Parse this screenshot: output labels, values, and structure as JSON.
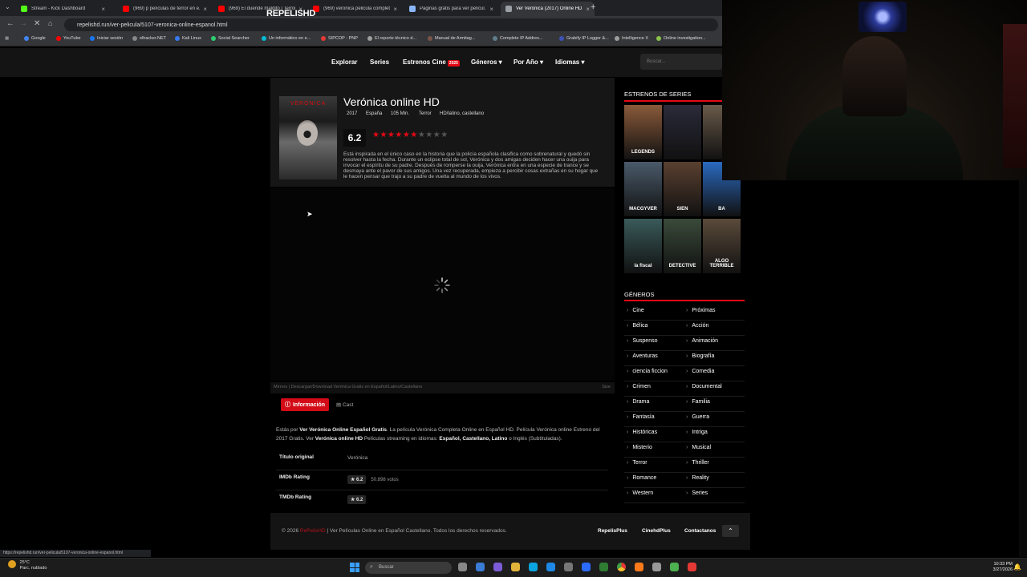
{
  "browser": {
    "tabs": [
      {
        "label": "Stream - Kick Dashboard",
        "color": "#53fc18"
      },
      {
        "label": "(969) p películas de terror en e...",
        "color": "#ff0000"
      },
      {
        "label": "(969) El duende maldito | Terror...",
        "color": "#ff0000"
      },
      {
        "label": "(969) veronica pelicula complet...",
        "color": "#ff0000"
      },
      {
        "label": "Páginas gratis para ver películ...",
        "color": "#8ab4f8"
      },
      {
        "label": "Ver Verónica (2017) Online HD...",
        "color": "#9aa0a6"
      }
    ],
    "new_tab": "+",
    "url": "repelishd.run/ver-pelicula/5107-veronica-online-espanol.html",
    "bookmarks": [
      {
        "label": "Google",
        "color": "#4285f4"
      },
      {
        "label": "YouTube",
        "color": "#ff0000"
      },
      {
        "label": "Iniciar sesión",
        "color": "#1877f2"
      },
      {
        "label": "elhacker.NET",
        "color": "#888888"
      },
      {
        "label": "Kali Linux",
        "color": "#367bf0"
      },
      {
        "label": "Social Searcher",
        "color": "#2ecc71"
      },
      {
        "label": "Un informático en e...",
        "color": "#00bcd4"
      },
      {
        "label": "SIPCOP - PNP",
        "color": "#e53935"
      },
      {
        "label": "El reporte técnico d...",
        "color": "#9e9e9e"
      },
      {
        "label": "Manual de Armitag...",
        "color": "#795548"
      },
      {
        "label": "Complete IP Addres...",
        "color": "#607d8b"
      },
      {
        "label": "Grabify IP Logger &...",
        "color": "#3f51b5"
      },
      {
        "label": "Intelligence X",
        "color": "#9e9e9e"
      },
      {
        "label": "Online investigation...",
        "color": "#8bc34a"
      }
    ],
    "status_url": "https://repelishd.run/ver-pelicula/5107-veronica-online-espanol.html"
  },
  "site": {
    "logo": "REPELISHD",
    "nav": {
      "explorar": "Explorar",
      "series": "Series",
      "estrenos": "Estrenos Cine",
      "estrenos_badge": "2025",
      "generos": "Géneros ▾",
      "por_anio": "Por Año ▾",
      "idiomas": "Idiomas ▾"
    },
    "search_placeholder": "Buscar..."
  },
  "movie": {
    "poster_title": "VERÓNICA",
    "title": "Verónica online HD",
    "year": "2017",
    "country": "España",
    "duration": "105 Min.",
    "genre": "Terror",
    "languages": "HD/latino, castellano",
    "rating": "6.2",
    "stars_filled": 6.2,
    "stars_total": 10,
    "synopsis": "Está inspirada en el único caso en la historia que la policía española clasifica como sobrenatural y quedó sin resolver hasta la fecha. Durante un eclipse total de sol, Verónica y dos amigas deciden hacer una ouija para invocar el espíritu de su padre. Después de romperse la ouija, Verónica entra en una especie de trance y se desmaya ante el pavor de sus amigos. Una vez recuperada, empieza a percibir cosas extrañas en su hogar que le hacen pensar que trajo a su padre de vuelta al mundo de los vivos."
  },
  "player": {
    "mirrors_text": "Mirrors | Descargar/Download Verónica Gratis en Español/Latino/Castellano",
    "size_label": "Size"
  },
  "info": {
    "tab_info": "Información",
    "tab_cast": "Cast",
    "about_1": "Estás por ",
    "about_b1": "Ver Verónica Online Español Gratis",
    "about_2": ". La película Verónica Completa Online en Español HD. Película Verónica online Estreno del 2017 Gratis. Ver ",
    "about_b2": "Verónica online HD",
    "about_3": " Películas streaming en idiomas: ",
    "about_b3": "Español, Castellano, Latino",
    "about_4": " o Inglés (Subtituladas).",
    "rows": [
      {
        "key": "Título original",
        "value": "Verónica"
      },
      {
        "key": "IMDb Rating",
        "value": "★ 6.2",
        "votes": "50,898 votos"
      },
      {
        "key": "TMDb Rating",
        "value": "★ 6.2"
      }
    ]
  },
  "footer": {
    "copy_prefix": "© 2026 ",
    "copy_brand": "RePelisHD",
    "copy_rest": " | Ver Películas Online en Español Castellano. Todos los derechos reservados.",
    "links": [
      "RepelisPlus",
      "CinehdPlus",
      "Contactanos"
    ],
    "up": "⌃"
  },
  "sidebar": {
    "series_title": "ESTRENOS DE SERIES",
    "series": [
      {
        "label": "LEGENDS",
        "color": "#8a5a3a"
      },
      {
        "label": "",
        "color": "#2a2a3a"
      },
      {
        "label": "",
        "color": "#6a5a4a"
      },
      {
        "label": "MACGYVER",
        "color": "#4a5a6a"
      },
      {
        "label": "SIEN",
        "color": "#5a4030"
      },
      {
        "label": "BA",
        "color": "#2a6ac0"
      },
      {
        "label": "la fiscal",
        "color": "#3a5a5a"
      },
      {
        "label": "DETECTIVE",
        "color": "#3a4a3a"
      },
      {
        "label": "ALGO TERRIBLE",
        "color": "#5a4a3a"
      }
    ],
    "genres_title": "GÉNEROS",
    "genres_left": [
      "Cine",
      "Bélica",
      "Suspenso",
      "Aventuras",
      "ciencia ficcion",
      "Crimen",
      "Drama",
      "Fantasía",
      "Históricas",
      "Misterio",
      "Terror",
      "Romance",
      "Western"
    ],
    "genres_right": [
      "Próximas",
      "Acción",
      "Animación",
      "Biografía",
      "Comedia",
      "Documental",
      "Familia",
      "Guerra",
      "Intriga",
      "Musical",
      "Thriller",
      "Reality",
      "Series"
    ]
  },
  "taskbar": {
    "weather_temp": "25°C",
    "weather_desc": "Parc. nublado",
    "search": "Buscar",
    "time": "10:33 PM",
    "date": "3/27/2026"
  }
}
